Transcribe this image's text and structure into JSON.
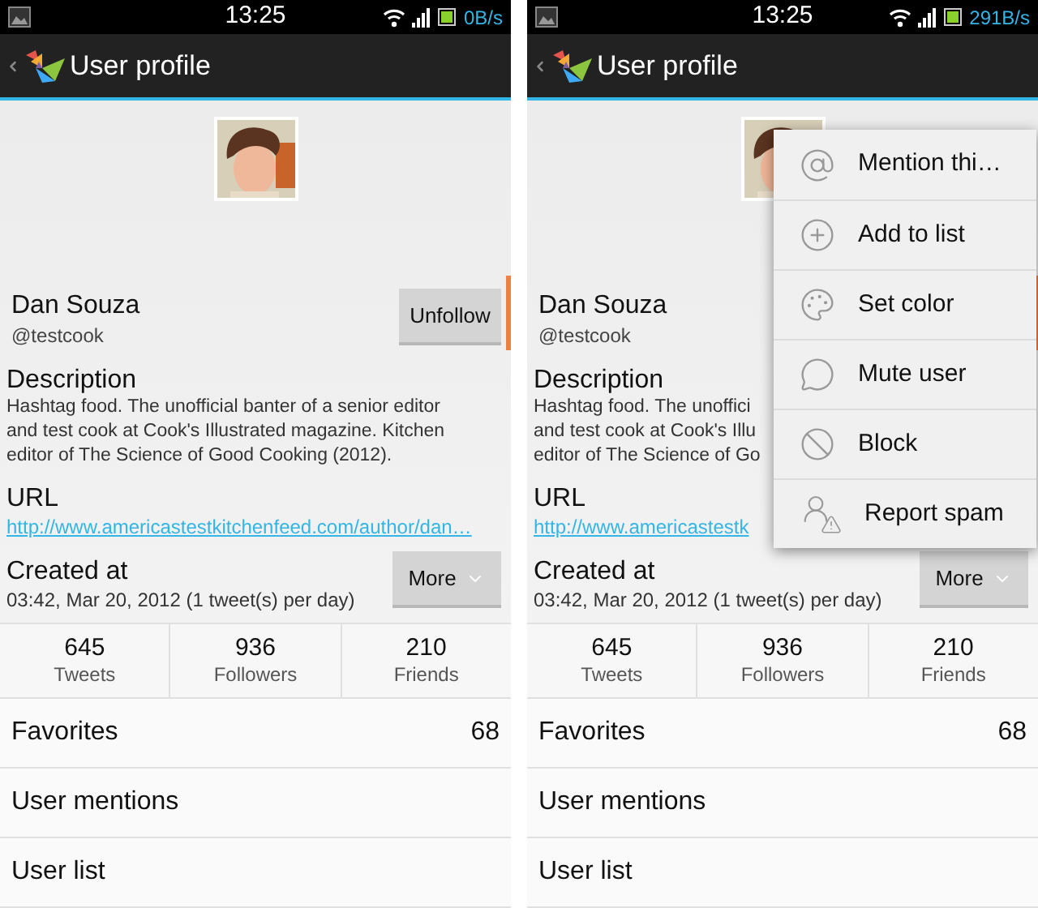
{
  "screens": [
    {
      "status_bar": {
        "time": "13:25",
        "speed": "0B/s"
      },
      "title": "User profile",
      "name": "Dan Souza",
      "handle": "@testcook",
      "follow_button": "Unfollow",
      "description_heading": "Description",
      "description_lines": [
        "Hashtag food. The unofficial banter of a senior editor",
        "and test cook at Cook's Illustrated magazine. Kitchen",
        "editor of The Science of Good Cooking (2012)."
      ],
      "url_heading": "URL",
      "url": "http://www.americastestkitchenfeed.com/author/dan…",
      "created_heading": "Created at",
      "created": "03:42, Mar 20, 2012 (1 tweet(s) per day)",
      "more_button": "More",
      "stats": [
        {
          "value": "645",
          "label": "Tweets"
        },
        {
          "value": "936",
          "label": "Followers"
        },
        {
          "value": "210",
          "label": "Friends"
        }
      ],
      "rows": [
        {
          "label": "Favorites",
          "count": "68"
        },
        {
          "label": "User mentions"
        },
        {
          "label": "User list"
        }
      ]
    },
    {
      "status_bar": {
        "time": "13:25",
        "speed": "291B/s"
      },
      "title": "User profile",
      "name": "Dan Souza",
      "handle": "@testcook",
      "description_heading": "Description",
      "description_lines": [
        "Hashtag food. The unoffici",
        "and test cook at Cook's Illu",
        "editor of The Science of Go"
      ],
      "url_heading": "URL",
      "url": "http://www.americastestk",
      "created_heading": "Created at",
      "created": "03:42, Mar 20, 2012 (1 tweet(s) per day)",
      "more_button": "More",
      "stats": [
        {
          "value": "645",
          "label": "Tweets"
        },
        {
          "value": "936",
          "label": "Followers"
        },
        {
          "value": "210",
          "label": "Friends"
        }
      ],
      "rows": [
        {
          "label": "Favorites",
          "count": "68"
        },
        {
          "label": "User mentions"
        },
        {
          "label": "User list"
        }
      ],
      "menu": [
        "Mention thi…",
        "Add to list",
        "Set color",
        "Mute user",
        "Block",
        "Report spam"
      ]
    }
  ]
}
